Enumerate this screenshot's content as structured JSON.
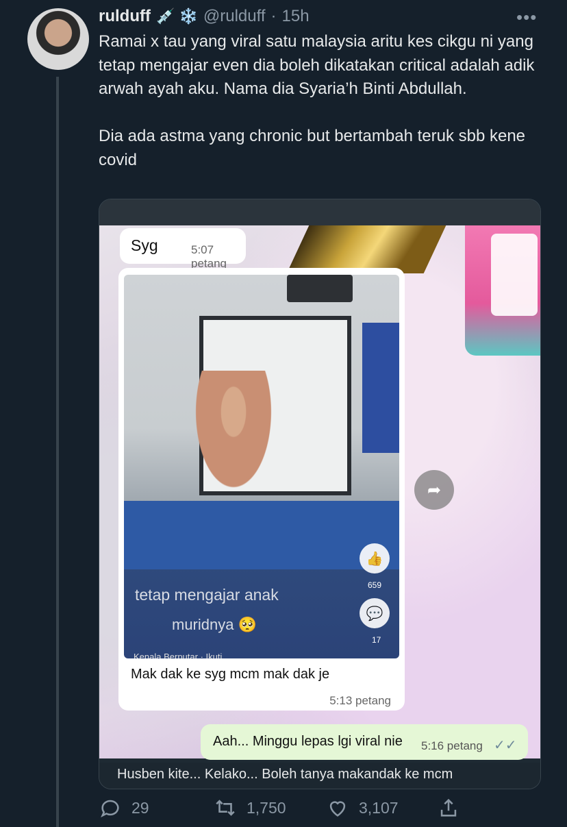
{
  "tweet": {
    "name": "rulduff",
    "emojis": "💉 ❄️",
    "handle": "@rulduff",
    "separator": "·",
    "time": "15h",
    "more_label": "•••",
    "text": "Ramai x tau yang viral satu malaysia aritu kes cikgu ni yang tetap mengajar even dia boleh dikatakan critical adalah adik arwah ayah aku. Nama dia Syaria’h Binti Abdullah.\n\nDia ada astma yang chronic but bertambah teruk sbb kene covid"
  },
  "media": {
    "bubble1": {
      "name": "Syg",
      "time": "5:07 petang"
    },
    "screen": {
      "text_line1": "tetap mengajar anak",
      "text_line2": "muridnya 🥺",
      "like_count": "659",
      "comment_count": "17",
      "footer": "Kenala Berputar · Ikuti"
    },
    "bubble2": {
      "caption": "Mak dak ke syg mcm mak dak je",
      "time": "5:13 petang"
    },
    "bubble3": {
      "message": "Aah... Minggu lepas lgi viral nie",
      "time": "5:16 petang",
      "ticks": "✓✓"
    },
    "subtitle": "Husben kite... Kelako... Boleh tanya makandak ke mcm"
  },
  "actions": {
    "reply_count": "29",
    "retweet_count": "1,750",
    "like_count": "3,107"
  }
}
